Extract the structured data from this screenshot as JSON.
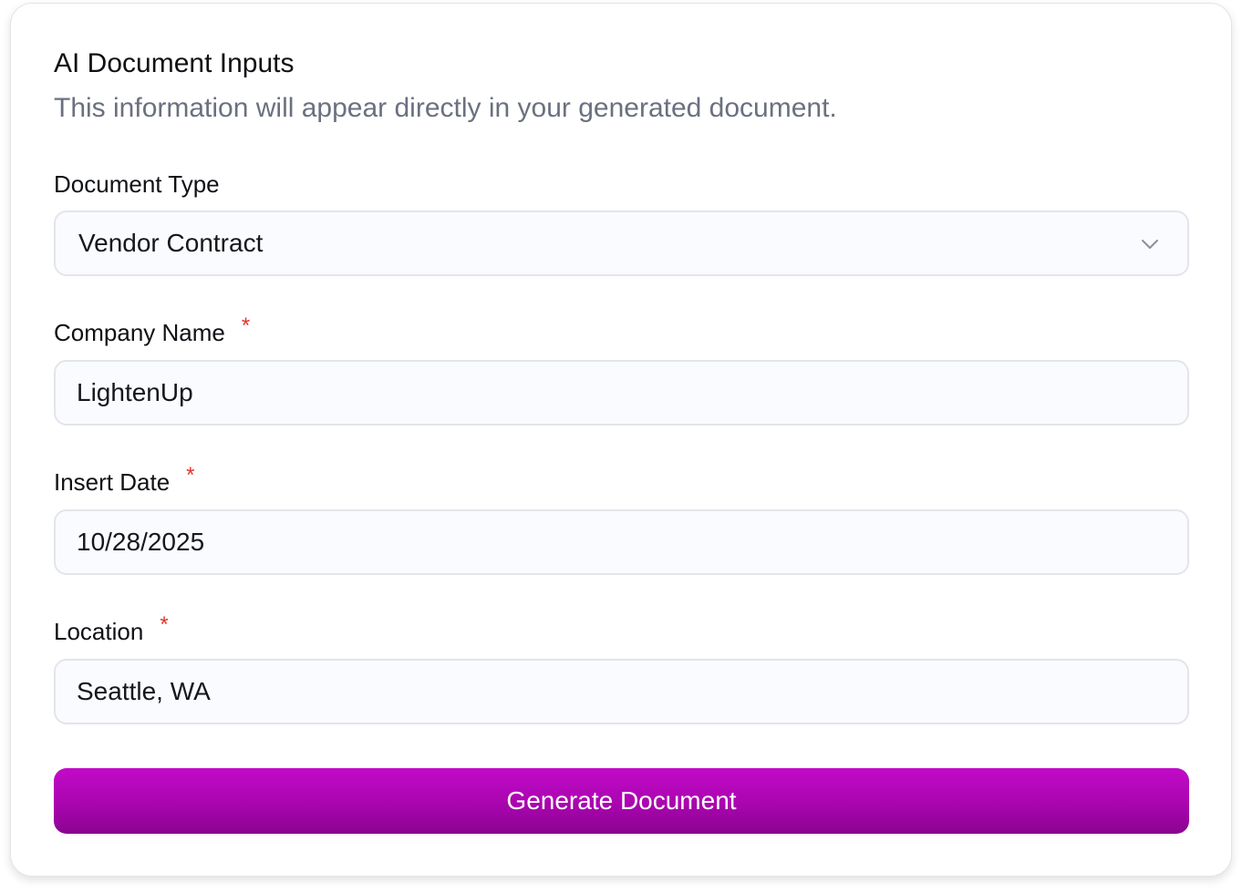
{
  "header": {
    "title": "AI Document Inputs",
    "subtitle": "This information will appear directly in your generated document."
  },
  "fields": {
    "document_type": {
      "label": "Document Type",
      "value": "Vendor Contract",
      "icon": "chevron-down-icon"
    },
    "company_name": {
      "label": "Company Name",
      "required_mark": "*",
      "value": "LightenUp"
    },
    "insert_date": {
      "label": "Insert Date",
      "required_mark": "*",
      "value": "10/28/2025"
    },
    "location": {
      "label": "Location",
      "required_mark": "*",
      "value": "Seattle, WA"
    }
  },
  "actions": {
    "generate_label": "Generate Document"
  },
  "colors": {
    "accent": "#b007b6",
    "required": "#e5322d",
    "muted_text": "#6b7080"
  }
}
